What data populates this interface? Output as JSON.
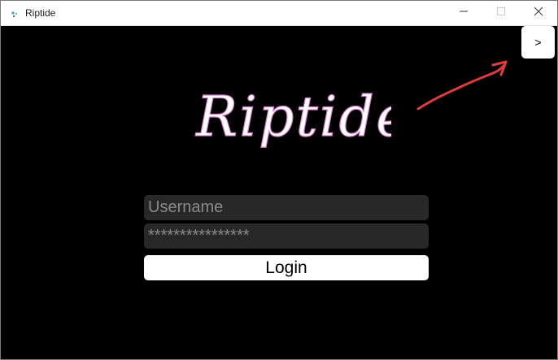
{
  "window": {
    "title": "Riptide",
    "icon": "app-icon",
    "controls": {
      "minimize_icon": "minimize-icon",
      "maximize_icon": "maximize-icon",
      "close_icon": "close-icon"
    }
  },
  "header": {
    "next_label": ">"
  },
  "logo": {
    "text": "Riptide",
    "color": "#ffffff",
    "accent": "#d07acb"
  },
  "annotation": {
    "arrow_color": "#e23b3b"
  },
  "form": {
    "username_placeholder": "Username",
    "password_value": "****************",
    "login_label": "Login"
  },
  "colors": {
    "background": "#000000",
    "field_bg": "#282828",
    "button_bg": "#ffffff"
  }
}
